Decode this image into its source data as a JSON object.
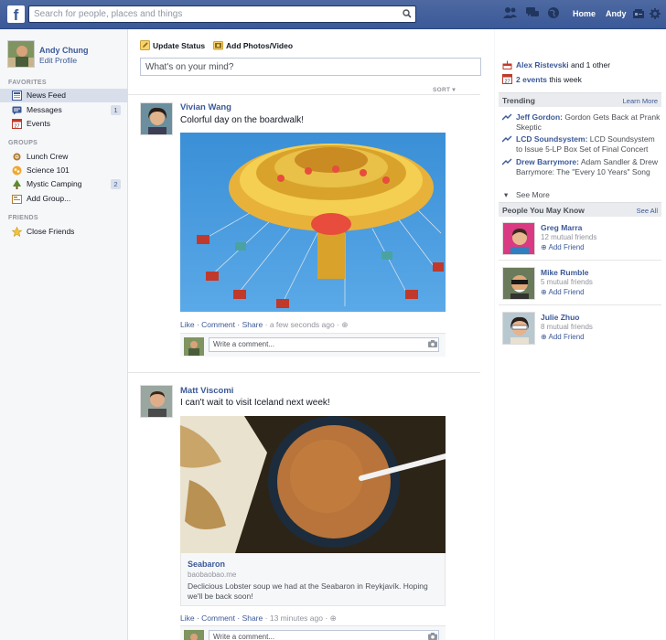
{
  "topbar": {
    "logo": "f",
    "search_placeholder": "Search for people, places and things",
    "home_label": "Home",
    "user_label": "Andy"
  },
  "sidebar": {
    "profile_name": "Andy Chung",
    "edit_profile": "Edit Profile",
    "favorites_header": "FAVORITES",
    "favorites": [
      {
        "label": "News Feed"
      },
      {
        "label": "Messages",
        "badge": "1"
      },
      {
        "label": "Events"
      }
    ],
    "groups_header": "GROUPS",
    "groups": [
      {
        "label": "Lunch Crew"
      },
      {
        "label": "Science 101"
      },
      {
        "label": "Mystic Camping",
        "badge": "2"
      },
      {
        "label": "Add Group..."
      }
    ],
    "friends_header": "FRIENDS",
    "friends": [
      {
        "label": "Close Friends"
      }
    ]
  },
  "composer": {
    "update_status": "Update Status",
    "add_photos": "Add Photos/Video",
    "placeholder": "What's on your mind?",
    "sort": "SORT"
  },
  "posts": [
    {
      "author": "Vivian Wang",
      "text": "Colorful day on the boardwalk!",
      "like": "Like",
      "comment": "Comment",
      "share": "Share",
      "time": "a few seconds ago",
      "comment_placeholder": "Write a comment..."
    },
    {
      "author": "Matt Viscomi",
      "text": "I can't wait to visit Iceland next week!",
      "link_title": "Seabaron",
      "link_domain": "baobaobao.me",
      "link_desc": "Declicious Lobster soup we had at the Seabaron in Reykjavík. Hoping we'll be back soon!",
      "like": "Like",
      "comment": "Comment",
      "share": "Share",
      "time": "13 minutes ago",
      "comment_placeholder": "Write a comment..."
    }
  ],
  "right": {
    "birthday_name": "Alex Ristevski",
    "birthday_rest": "and 1 other",
    "events_count": "2 events",
    "events_rest": "this week",
    "trending_header": "Trending",
    "learn_more": "Learn More",
    "trending": [
      {
        "topic": "Jeff Gordon:",
        "desc": "Gordon Gets Back at Prank Skeptic"
      },
      {
        "topic": "LCD Soundsystem:",
        "desc": "LCD Soundsystem to Issue 5-LP Box Set of Final Concert"
      },
      {
        "topic": "Drew Barrymore:",
        "desc": "Adam Sandler & Drew Barrymore: The \"Every 10 Years\" Song"
      }
    ],
    "see_more": "See More",
    "pymk_header": "People You May Know",
    "see_all": "See All",
    "people": [
      {
        "name": "Greg Marra",
        "mutual": "12 mutual friends",
        "add": "Add Friend"
      },
      {
        "name": "Mike Rumble",
        "mutual": "5 mutual friends",
        "add": "Add Friend"
      },
      {
        "name": "Julie Zhuo",
        "mutual": "8 mutual friends",
        "add": "Add Friend"
      }
    ]
  }
}
